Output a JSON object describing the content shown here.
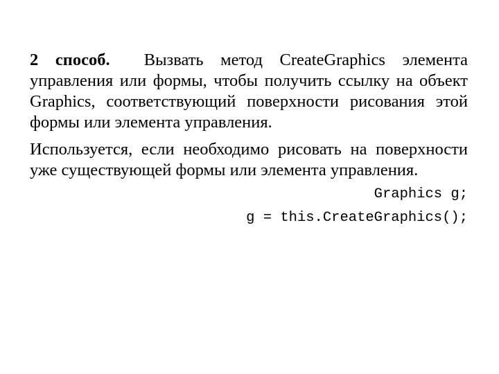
{
  "slide": {
    "paragraph1": {
      "lead_bold": "2 способ.",
      "text": "Вызвать  метод CreateGraphics элемента управления или формы, чтобы получить ссылку на объект Graphics, соответствующий поверхности рисования этой формы или элемента управления."
    },
    "paragraph2": {
      "text": "Используется, если необходимо рисовать на поверхности уже существующей формы или элемента управления."
    },
    "code": [
      "Graphics g;",
      "g = this.CreateGraphics();"
    ]
  }
}
